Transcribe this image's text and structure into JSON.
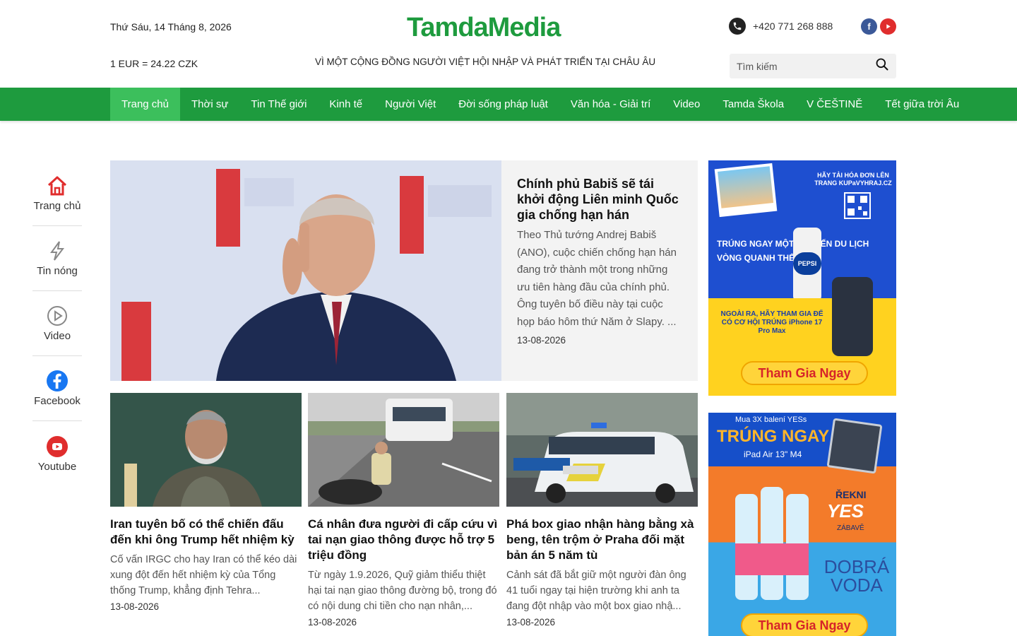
{
  "header": {
    "date": "Thứ Sáu, 14 Tháng 8, 2026",
    "exchange_rate": "1 EUR = 24.22 CZK",
    "logo": "TamdaMedia",
    "tagline": "VÌ MỘT CỘNG ĐỒNG NGƯỜI VIỆT HỘI NHẬP VÀ PHÁT TRIỂN TẠI CHÂU ÂU",
    "phone": "+420 771 268 888",
    "search_placeholder": "Tìm kiếm"
  },
  "nav": [
    {
      "label": "Trang chủ",
      "active": true
    },
    {
      "label": "Thời sự"
    },
    {
      "label": "Tin Thế giới"
    },
    {
      "label": "Kinh tế"
    },
    {
      "label": "Người Việt"
    },
    {
      "label": "Đời sống pháp luật"
    },
    {
      "label": "Văn hóa - Giải trí"
    },
    {
      "label": "Video"
    },
    {
      "label": "Tamda Škola"
    },
    {
      "label": "V ČEŠTINĚ"
    },
    {
      "label": "Tết giữa trời Âu"
    }
  ],
  "sidebar": [
    {
      "label": "Trang chủ",
      "icon": "home-icon"
    },
    {
      "label": "Tin nóng",
      "icon": "lightning-icon"
    },
    {
      "label": "Video",
      "icon": "play-icon"
    },
    {
      "label": "Facebook",
      "icon": "facebook-icon"
    },
    {
      "label": "Youtube",
      "icon": "youtube-icon"
    }
  ],
  "featured": {
    "title": "Chính phủ Babiš sẽ tái khởi động Liên minh Quốc gia chống hạn hán",
    "description": "Theo Thủ tướng Andrej Babiš (ANO), cuộc chiến chống hạn hán đang trở thành một trong những ưu tiên hàng đầu của chính phủ. Ông tuyên bố điều này tại cuộc họp báo hôm thứ Năm ở Slapy. ...",
    "date": "13-08-2026"
  },
  "articles": [
    {
      "title": "Iran tuyên bố có thể chiến đấu đến khi ông Trump hết nhiệm kỳ",
      "description": "Cố vấn IRGC cho hay Iran có thể kéo dài xung đột đến hết nhiệm kỳ của Tổng thống Trump, khẳng định Tehra...",
      "date": "13-08-2026"
    },
    {
      "title": "Cá nhân đưa người đi cấp cứu vì tai nạn giao thông được hỗ trợ 5 triệu đồng",
      "description": "Từ ngày 1.9.2026, Quỹ giảm thiểu thiệt hại tai nạn giao thông đường bộ, trong đó có nội dung chi tiền cho nạn nhân,...",
      "date": "13-08-2026"
    },
    {
      "title": "Phá box giao nhận hàng bằng xà beng, tên trộm ở Praha đối mặt bản án 5 năm tù",
      "description": "Cảnh sát đã bắt giữ một người đàn ông 41 tuổi ngay tại hiện trường khi anh ta đang đột nhập vào một box giao nhậ...",
      "date": "13-08-2026"
    }
  ],
  "ads": {
    "ad1": {
      "top_text": "HÃY TẢI HÓA ĐƠN LÊN TRANG KUPaVYHRAJ.CZ",
      "headline": "TRÚNG NGAY MỘT CHUYẾN DU LỊCH VÒNG QUANH THẾ GIỚI",
      "sub": "NGOÀI RA, HÃY THAM GIA ĐỂ CÓ CƠ HỘI TRÚNG iPhone 17 Pro Max",
      "button": "Tham Gia Ngay",
      "brand": "PEPSI"
    },
    "ad2": {
      "top_text": "Mua 3X balení YESs",
      "headline": "TRÚNG NGAY",
      "product": "iPad Air 13\" M4",
      "brand_small": "ŘEKNI",
      "brand": "YES",
      "brand_small2": "ZÁBAVĚ",
      "slogan": "DOBRÁ VODA",
      "button": "Tham Gia Ngay"
    }
  },
  "colors": {
    "brand_green": "#1e9b3e",
    "nav_active": "#3cbf5c",
    "facebook": "#3b5998",
    "youtube": "#e02d2d"
  }
}
